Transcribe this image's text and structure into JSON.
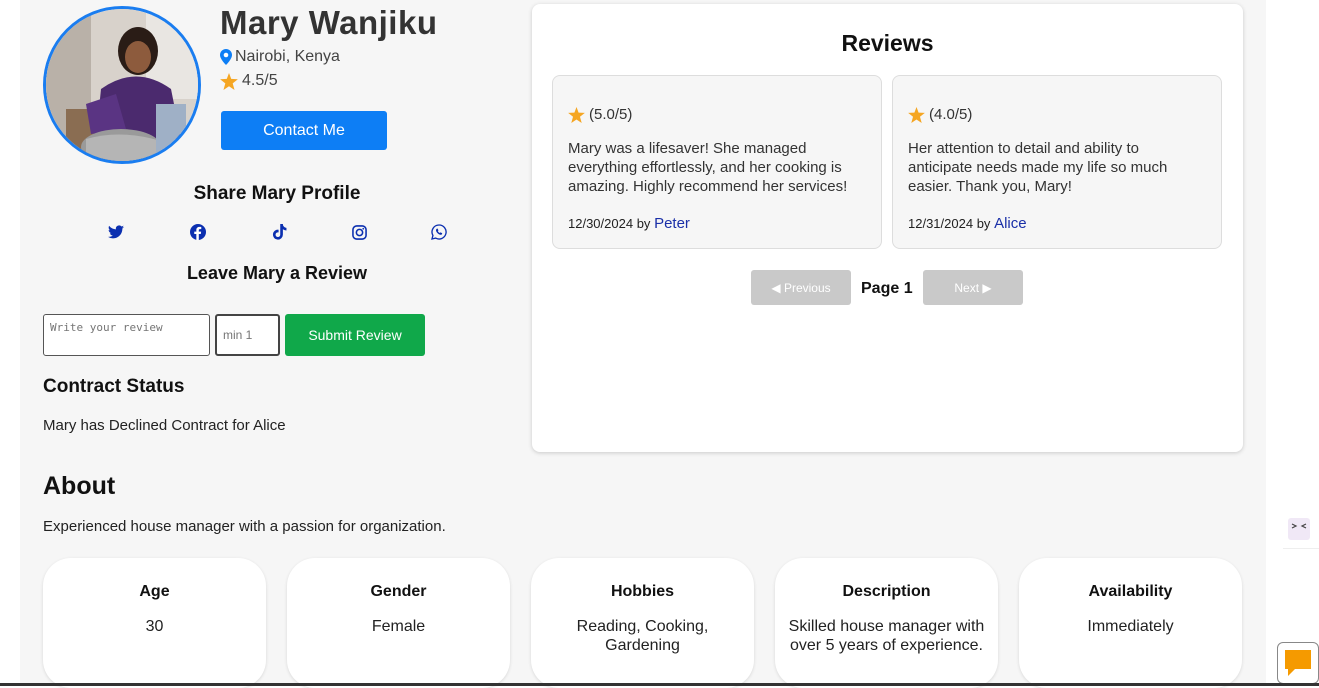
{
  "profile": {
    "name": "Mary Wanjiku",
    "location": "Nairobi, Kenya",
    "rating": "4.5/5",
    "contact_label": "Contact Me"
  },
  "share": {
    "title": "Share Mary Profile",
    "icons": [
      "twitter-icon",
      "facebook-icon",
      "tiktok-icon",
      "instagram-icon",
      "whatsapp-icon"
    ]
  },
  "leave_review": {
    "title": "Leave Mary a Review",
    "text_placeholder": "Write your review",
    "rating_placeholder": "min 1",
    "submit_label": "Submit Review"
  },
  "contract": {
    "title": "Contract Status",
    "status": "Mary has Declined Contract for Alice"
  },
  "reviews": {
    "heading": "Reviews",
    "items": [
      {
        "score": "(5.0/5)",
        "text": "Mary was a lifesaver! She managed everything effortlessly, and her cooking is amazing. Highly recommend her services!",
        "date": "12/30/2024",
        "by": "by",
        "author": "Peter"
      },
      {
        "score": "(4.0/5)",
        "text": "Her attention to detail and ability to anticipate needs made my life so much easier. Thank you, Mary!",
        "date": "12/31/2024",
        "by": "by",
        "author": "Alice"
      }
    ],
    "prev_label": "◀ Previous",
    "next_label": "Next ▶",
    "page_label": "Page 1"
  },
  "about": {
    "title": "About",
    "text": "Experienced house manager with a passion for organization.",
    "cards": [
      {
        "label": "Age",
        "value": "30"
      },
      {
        "label": "Gender",
        "value": "Female"
      },
      {
        "label": "Hobbies",
        "value": "Reading, Cooking, Gardening"
      },
      {
        "label": "Description",
        "value": "Skilled house manager with over 5 years of experience."
      },
      {
        "label": "Availability",
        "value": "Immediately"
      }
    ]
  },
  "colors": {
    "primary": "#0d7ef5",
    "success": "#10a84a",
    "star": "#f5a623",
    "disabled": "#c9c9c9",
    "author_link": "#1a2fa8"
  }
}
